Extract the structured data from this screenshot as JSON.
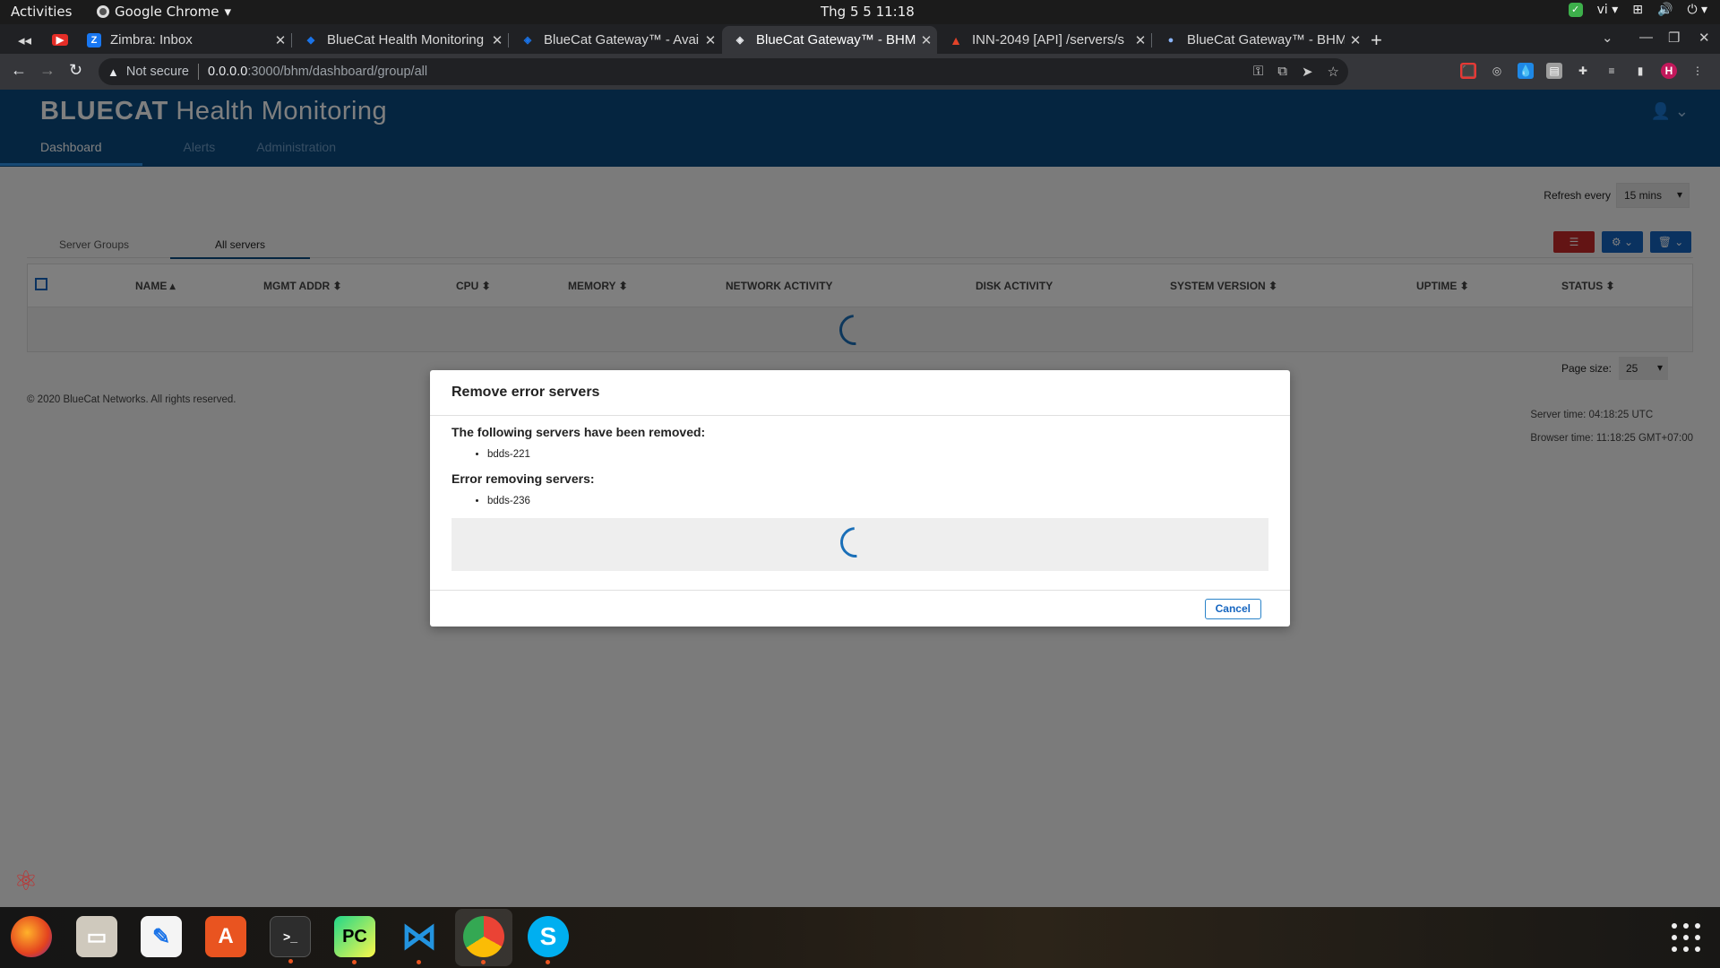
{
  "system": {
    "activities": "Activities",
    "app_name": "Google Chrome",
    "clock": "Thg 5 5  11:18",
    "lang": "vi"
  },
  "tabs": [
    {
      "title": "Zimbra: Inbox",
      "fav": "Z",
      "color": "#1877f2"
    },
    {
      "title": "BlueCat Health Monitoring",
      "fav": "◆",
      "color": "#1a73e8"
    },
    {
      "title": "BlueCat Gateway™ - Avail",
      "fav": "◈",
      "color": "#1a73e8"
    },
    {
      "title": "BlueCat Gateway™ - BHM",
      "fav": "◈",
      "color": "#5f6368"
    },
    {
      "title": "INN-2049 [API] /servers/s",
      "fav": "▲",
      "color": "#e24329"
    },
    {
      "title": "BlueCat Gateway™ - BHM",
      "fav": "●",
      "color": "#8ab4f8"
    }
  ],
  "omnibox": {
    "security": "Not secure",
    "host": "0.0.0.0",
    "path": ":3000/bhm/dashboard/group/all"
  },
  "profile_initial": "H",
  "app": {
    "brand": "BLUECAT",
    "product": "Health Monitoring",
    "nav": [
      "Dashboard",
      "Alerts",
      "Administration"
    ],
    "refresh_label": "Refresh every",
    "refresh_value": "15 mins",
    "subtabs": [
      "Server Groups",
      "All servers"
    ],
    "columns": [
      "NAME ▴",
      "MGMT ADDR ⬍",
      "CPU ⬍",
      "MEMORY ⬍",
      "NETWORK ACTIVITY",
      "DISK ACTIVITY",
      "SYSTEM VERSION ⬍",
      "UPTIME ⬍",
      "STATUS ⬍"
    ],
    "page_size_label": "Page size:",
    "page_size": "25",
    "footer": "© 2020 BlueCat Networks. All rights reserved.",
    "server_time": "Server time: 04:18:25 UTC",
    "browser_time": "Browser time: 11:18:25 GMT+07:00"
  },
  "modal": {
    "title": "Remove error servers",
    "removed_heading": "The following servers have been removed:",
    "removed": [
      "bdds-221"
    ],
    "error_heading": "Error removing servers:",
    "errors": [
      "bdds-236"
    ],
    "cancel": "Cancel"
  },
  "colors": {
    "header_bg": "#0a4b80",
    "danger": "#c62828",
    "primary": "#1565c0"
  }
}
